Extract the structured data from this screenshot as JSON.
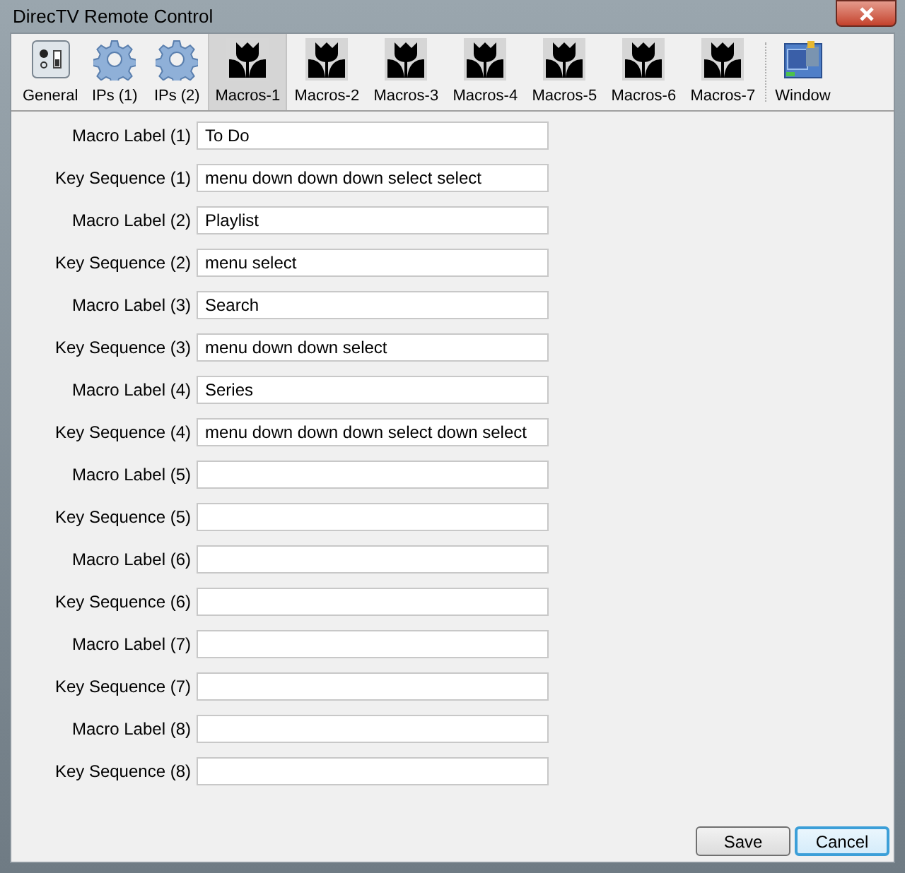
{
  "window": {
    "title": "DirecTV Remote Control"
  },
  "toolbar": {
    "items": [
      {
        "label": "General",
        "kind": "general",
        "selected": false
      },
      {
        "label": "IPs (1)",
        "kind": "gear",
        "selected": false
      },
      {
        "label": "IPs (2)",
        "kind": "gear",
        "selected": false
      },
      {
        "label": "Macros-1",
        "kind": "macro",
        "selected": true
      },
      {
        "label": "Macros-2",
        "kind": "macro",
        "selected": false
      },
      {
        "label": "Macros-3",
        "kind": "macro",
        "selected": false
      },
      {
        "label": "Macros-4",
        "kind": "macro",
        "selected": false
      },
      {
        "label": "Macros-5",
        "kind": "macro",
        "selected": false
      },
      {
        "label": "Macros-6",
        "kind": "macro",
        "selected": false
      },
      {
        "label": "Macros-7",
        "kind": "macro",
        "selected": false
      },
      {
        "label": "Window",
        "kind": "window",
        "selected": false
      }
    ]
  },
  "form": {
    "rows": [
      {
        "label": "Macro Label (1)",
        "value": "To Do"
      },
      {
        "label": "Key Sequence (1)",
        "value": "menu down down down select select"
      },
      {
        "label": "Macro Label (2)",
        "value": "Playlist"
      },
      {
        "label": "Key Sequence (2)",
        "value": "menu select"
      },
      {
        "label": "Macro Label (3)",
        "value": "Search"
      },
      {
        "label": "Key Sequence (3)",
        "value": "menu down down select"
      },
      {
        "label": "Macro Label (4)",
        "value": "Series"
      },
      {
        "label": "Key Sequence (4)",
        "value": "menu down down down select down select"
      },
      {
        "label": "Macro Label (5)"
      },
      {
        "label": "Key Sequence (5)"
      },
      {
        "label": "Macro Label (6)"
      },
      {
        "label": "Key Sequence (6)"
      },
      {
        "label": "Macro Label (7)"
      },
      {
        "label": "Key Sequence (7)"
      },
      {
        "label": "Macro Label (8)"
      },
      {
        "label": "Key Sequence (8)"
      }
    ]
  },
  "buttons": [
    {
      "label": "Save",
      "focused": false
    },
    {
      "label": "Cancel",
      "focused": true
    }
  ]
}
